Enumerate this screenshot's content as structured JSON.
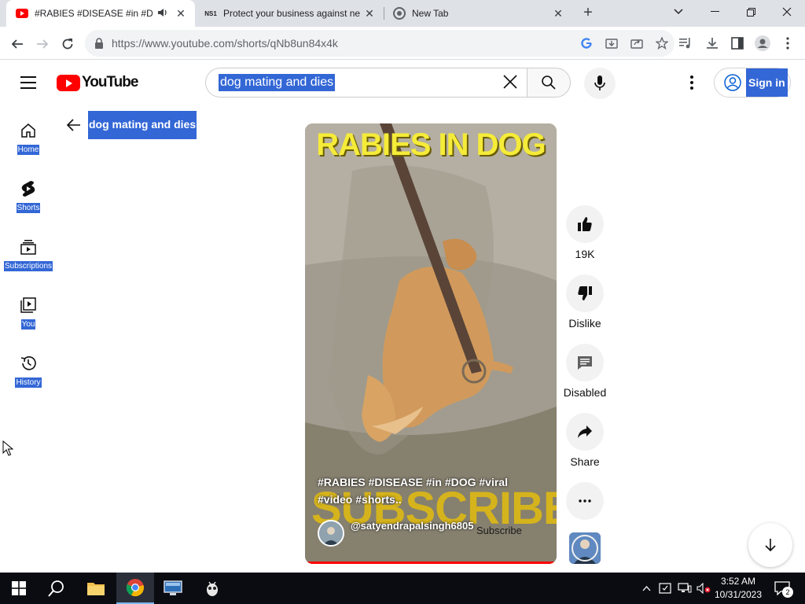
{
  "browser": {
    "tabs": [
      {
        "title": "#RABIES #DISEASE #in #DOG",
        "active": true
      },
      {
        "title": "Protect your business against ne",
        "active": false
      },
      {
        "title": "New Tab",
        "active": false
      }
    ],
    "new_tab_label": "+",
    "url": "https://www.youtube.com/shorts/qNb8un84x4k"
  },
  "youtube": {
    "logo_text": "YouTube",
    "search_query": "dog mating and dies",
    "signin_label": "Sign in",
    "guide": [
      {
        "label": "Home",
        "icon": "home-icon"
      },
      {
        "label": "Shorts",
        "icon": "shorts-icon"
      },
      {
        "label": "Subscriptions",
        "icon": "subscriptions-icon"
      },
      {
        "label": "You",
        "icon": "you-icon"
      },
      {
        "label": "History",
        "icon": "history-icon"
      }
    ],
    "query_heading": "dog mating and dies"
  },
  "short": {
    "overlay_title": "RABIES IN DOG",
    "description": "#RABIES #DISEASE #in #DOG #viral #video #shorts..",
    "overlay_subscribe": "SUBSCRIBE",
    "channel": "@satyendrapalsingh6805",
    "subscribe_label": "Subscribe",
    "progress": 1.0
  },
  "actions": {
    "like_count": "19K",
    "dislike_label": "Dislike",
    "comments_label": "Disabled",
    "share_label": "Share"
  },
  "taskbar": {
    "time": "3:52 AM",
    "date": "10/31/2023",
    "notification_count": "2"
  },
  "colors": {
    "yt_red": "#ff0000",
    "selection_blue": "#3367d6",
    "overlay_yellow": "#f5eb39"
  }
}
